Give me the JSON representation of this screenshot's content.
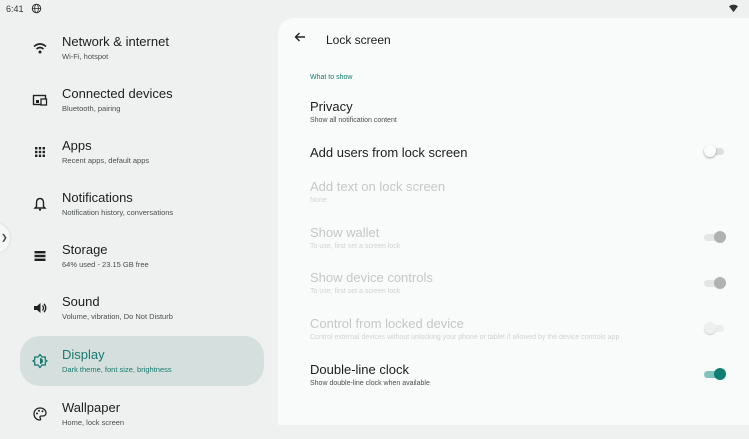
{
  "status_bar": {
    "time": "6:41"
  },
  "nav": {
    "items": [
      {
        "title": "Network & internet",
        "subtitle": "Wi-Fi, hotspot",
        "icon": "wifi-icon"
      },
      {
        "title": "Connected devices",
        "subtitle": "Bluetooth, pairing",
        "icon": "connected-devices-icon"
      },
      {
        "title": "Apps",
        "subtitle": "Recent apps, default apps",
        "icon": "apps-grid-icon"
      },
      {
        "title": "Notifications",
        "subtitle": "Notification history, conversations",
        "icon": "bell-icon"
      },
      {
        "title": "Storage",
        "subtitle": "64% used - 23.15 GB free",
        "icon": "storage-icon"
      },
      {
        "title": "Sound",
        "subtitle": "Volume, vibration, Do Not Disturb",
        "icon": "speaker-icon"
      },
      {
        "title": "Display",
        "subtitle": "Dark theme, font size, brightness",
        "icon": "display-brightness-icon",
        "selected": true
      },
      {
        "title": "Wallpaper",
        "subtitle": "Home, lock screen",
        "icon": "palette-icon"
      }
    ]
  },
  "detail": {
    "title": "Lock screen",
    "section": "What to show",
    "settings": [
      {
        "title": "Privacy",
        "subtitle": "Show all notification content",
        "enabled": true
      },
      {
        "title": "Add users from lock screen",
        "subtitle": "",
        "enabled": true,
        "toggle": "off"
      },
      {
        "title": "Add text on lock screen",
        "subtitle": "None",
        "enabled": false
      },
      {
        "title": "Show wallet",
        "subtitle": "To use, first set a screen lock",
        "enabled": false,
        "toggle": "on"
      },
      {
        "title": "Show device controls",
        "subtitle": "To use, first set a screen lock",
        "enabled": false,
        "toggle": "on"
      },
      {
        "title": "Control from locked device",
        "subtitle": "Control external devices without unlocking your phone or tablet if allowed by the device controls app",
        "enabled": false,
        "toggle": "off"
      },
      {
        "title": "Double-line clock",
        "subtitle": "Show double-line clock when available",
        "enabled": true,
        "toggle": "on"
      }
    ]
  },
  "colors": {
    "accent": "#167a70",
    "selected_bg": "#d5dfdd",
    "toggle_on": "#0f7f73"
  }
}
